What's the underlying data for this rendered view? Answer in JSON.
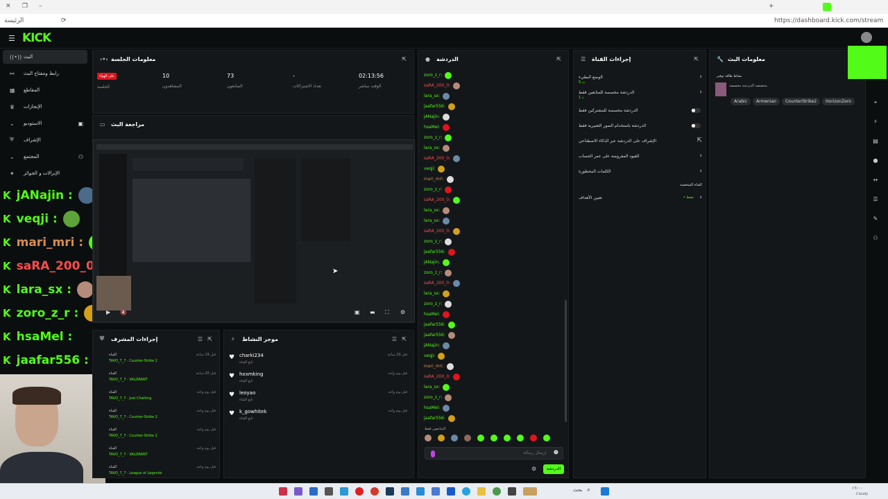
{
  "browser": {
    "url": "https://dashboard.kick.com/stream",
    "tab_label": "الرئيسة"
  },
  "brand": {
    "logo_text": "KICK",
    "accent": "#53fc18"
  },
  "sidebar": {
    "items": [
      {
        "label": "البث",
        "icon": "broadcast-icon"
      },
      {
        "label": "رابط ومفتاح البث",
        "icon": "link-icon"
      },
      {
        "label": "المقاطع",
        "icon": "clips-icon"
      },
      {
        "label": "الإنجازات",
        "icon": "trophy-icon"
      },
      {
        "label": "الاستوديو",
        "icon": "chevron-down-icon"
      },
      {
        "label": "الإشراف",
        "icon": "shield-icon"
      },
      {
        "label": "المجتمع",
        "icon": "chevron-down-icon"
      },
      {
        "label": "الإنزالات و الجوائز",
        "icon": "gift-icon"
      }
    ]
  },
  "overlay_chat": [
    {
      "user": "jANajin :",
      "color": "#53fc18"
    },
    {
      "user": "veqji :",
      "color": "#53fc18"
    },
    {
      "user": "mari_mri :",
      "color": "#d98c4c"
    },
    {
      "user": "saRA_200_0 :",
      "color": "#ff4d4d"
    },
    {
      "user": "lara_sx :",
      "color": "#53fc18"
    },
    {
      "user": "zoro_z_r :",
      "color": "#53fc18"
    },
    {
      "user": "hsaMel :",
      "color": "#53fc18"
    },
    {
      "user": "jaafar556 :",
      "color": "#53fc18"
    }
  ],
  "session": {
    "title": "معلومات الجلسة",
    "live_badge": "على الهواء",
    "stats": [
      {
        "value": "",
        "label": "الجلسة"
      },
      {
        "value": "10",
        "label": "المشاهدون"
      },
      {
        "value": "73",
        "label": "المتابعون"
      },
      {
        "value": "-",
        "label": "تعداد الاشتراكات"
      },
      {
        "value": "02:13:56",
        "label": "الوقت مباشر"
      }
    ]
  },
  "preview": {
    "title": "مراجعة البث"
  },
  "chat": {
    "title": "الدردشة",
    "messages": [
      {
        "user": "zoro_z_r:",
        "color": "#53fc18"
      },
      {
        "user": "saRA_200_0:",
        "color": "#ff4d4d"
      },
      {
        "user": "lara_sx:",
        "color": "#53fc18"
      },
      {
        "user": "jaafar556:",
        "color": "#53fc18"
      },
      {
        "user": "jANajin:",
        "color": "#53fc18"
      },
      {
        "user": "hsaMel:",
        "color": "#53fc18"
      },
      {
        "user": "zoro_z_r:",
        "color": "#53fc18"
      },
      {
        "user": "lara_sx:",
        "color": "#53fc18"
      },
      {
        "user": "saRA_200_0:",
        "color": "#ff4d4d"
      },
      {
        "user": "veqji:",
        "color": "#53fc18"
      },
      {
        "user": "mari_mri:",
        "color": "#d98c4c"
      },
      {
        "user": "zoro_z_r:",
        "color": "#53fc18"
      },
      {
        "user": "saRA_200_0:",
        "color": "#ff4d4d"
      },
      {
        "user": "lara_sx:",
        "color": "#53fc18"
      },
      {
        "user": "lara_sx:",
        "color": "#53fc18"
      },
      {
        "user": "saRA_200_0:",
        "color": "#ff4d4d"
      },
      {
        "user": "zoro_z_r:",
        "color": "#53fc18"
      },
      {
        "user": "jaafar556:",
        "color": "#53fc18"
      },
      {
        "user": "jANajin:",
        "color": "#53fc18"
      },
      {
        "user": "zoro_z_r:",
        "color": "#53fc18"
      },
      {
        "user": "saRA_200_0:",
        "color": "#ff4d4d"
      },
      {
        "user": "lara_sx:",
        "color": "#53fc18"
      },
      {
        "user": "zoro_z_r:",
        "color": "#53fc18"
      },
      {
        "user": "hsaMel:",
        "color": "#53fc18"
      },
      {
        "user": "jaafar556:",
        "color": "#53fc18"
      },
      {
        "user": "jaafar556:",
        "color": "#53fc18"
      },
      {
        "user": "jANajin:",
        "color": "#53fc18"
      },
      {
        "user": "veqji:",
        "color": "#53fc18"
      },
      {
        "user": "mari_mri:",
        "color": "#d98c4c"
      },
      {
        "user": "saRA_200_0:",
        "color": "#ff4d4d"
      },
      {
        "user": "lara_sx:",
        "color": "#53fc18"
      },
      {
        "user": "zoro_z_r:",
        "color": "#53fc18"
      },
      {
        "user": "hsaMel:",
        "color": "#53fc18"
      },
      {
        "user": "jaafar556:",
        "color": "#53fc18"
      }
    ],
    "followers_only": "المتابعون فقط",
    "input_placeholder": "إرسال رسالة",
    "send_label": "الدردشة"
  },
  "channel_actions": {
    "title": "إجراءات القناة",
    "rows": [
      {
        "label": "الوضع البطيء",
        "sub": "5 ث",
        "type": "arrow"
      },
      {
        "label": "الدردشة مخصصة للمتابعين فقط",
        "sub": "1 د",
        "type": "arrow"
      },
      {
        "label": "الدردشة مخصصة للمشتركين فقط",
        "sub": "",
        "type": "toggle"
      },
      {
        "label": "الدردشة باستخدام الصور التعبيرية فقط",
        "sub": "",
        "type": "toggle"
      },
      {
        "label": "الإشراف على الدردشة عبر الذكاء الاصطناعي",
        "sub": "",
        "type": "link"
      },
      {
        "label": "القيود المفروضة على عمر الحساب",
        "sub": "",
        "type": "arrow"
      },
      {
        "label": "الكلمات المحظورة",
        "sub": "",
        "type": "arrow"
      }
    ],
    "section_label": "القناة الشخصية",
    "goals_label": "تعيين الأهداف",
    "goals_value": "• نشط"
  },
  "stream_info": {
    "title": "معلومات البث",
    "stream_title": "نشاط طاقة توفير",
    "category": "مخصصة الدردشة مخصصة",
    "tags": [
      "Arabic",
      "Armenian",
      "CounterStrike2",
      "HorizonZero"
    ]
  },
  "mod_actions": {
    "title": "إجراءات المشرف",
    "rows": [
      {
        "a": "القناة",
        "user": "TAVO_7_7",
        "game": "Counter-Strike 2",
        "time": "قبل 19 ساعة"
      },
      {
        "a": "القناة",
        "user": "TAVO_7_7",
        "game": "VALORANT",
        "time": "قبل 20 ساعة"
      },
      {
        "a": "القناة",
        "user": "TAVO_7_7",
        "game": "Just Chatting",
        "time": "قبل يوم واحد"
      },
      {
        "a": "القناة",
        "user": "TAVO_7_7",
        "game": "Counter-Strike 2",
        "time": "قبل يوم واحد"
      },
      {
        "a": "القناة",
        "user": "TAVO_7_7",
        "game": "Counter-Strike 2",
        "time": "قبل يوم واحد"
      },
      {
        "a": "القناة",
        "user": "TAVO_7_7",
        "game": "VALORANT",
        "time": "قبل يوم واحد"
      },
      {
        "a": "القناة",
        "user": "TAVO_7_7",
        "game": "League of Legends",
        "time": "قبل يوم واحد"
      }
    ]
  },
  "activity": {
    "title": "موجز النشاط",
    "rows": [
      {
        "name": "charki234",
        "sub": "تابع القناة",
        "time": "قبل 20 ساعة"
      },
      {
        "name": "hxxmking",
        "sub": "تابع القناة",
        "time": "قبل يوم واحد"
      },
      {
        "name": "leoyao",
        "sub": "تابع القناة",
        "time": "قبل يوم واحد"
      },
      {
        "name": "k_gowhitek",
        "sub": "تابع القناة",
        "time": "قبل يوم واحد"
      }
    ]
  },
  "taskbar": {
    "search_label": "بحث",
    "clock": "١٦:٠٠",
    "weather": "Cloudy"
  }
}
